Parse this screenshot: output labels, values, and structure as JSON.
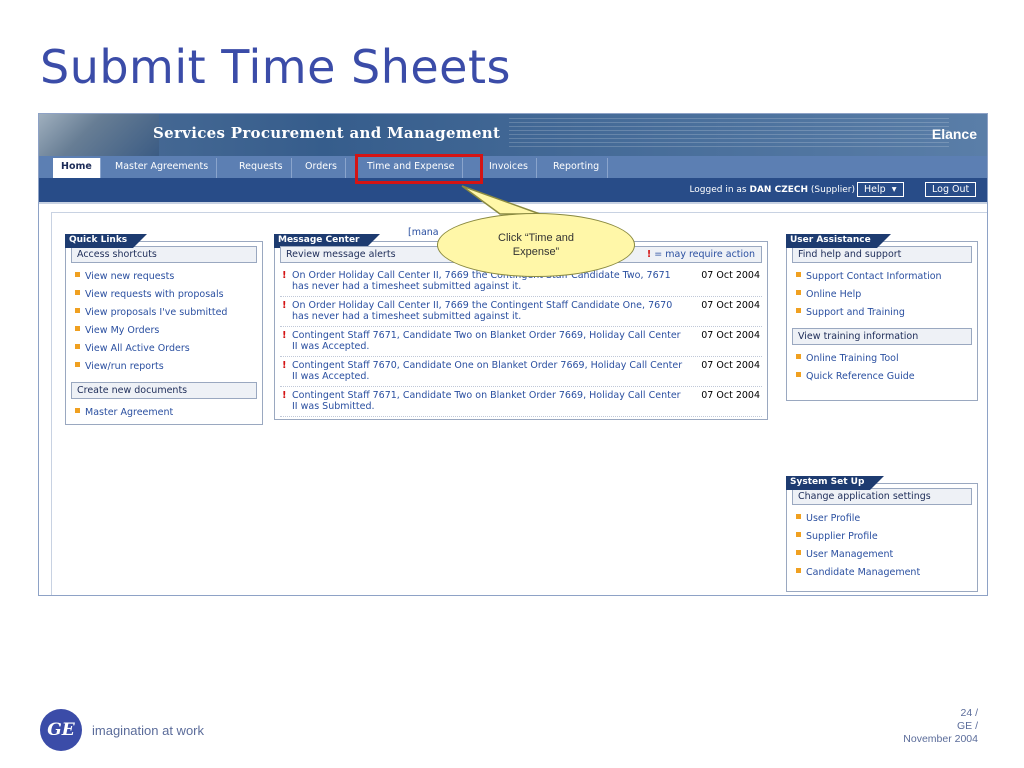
{
  "slide": {
    "title": "Submit Time Sheets",
    "callout": "Click “Time and Expense”",
    "tagline": "imagination at work",
    "logo_text": "GE",
    "page_number": "24 /",
    "company": "GE /",
    "date": "November 2004"
  },
  "app": {
    "banner_title": "Services Procurement and Management",
    "banner_logo": "Elance",
    "tabs": [
      {
        "label": "Home",
        "active": true
      },
      {
        "label": "Master Agreements",
        "active": false
      },
      {
        "label": "Requests",
        "active": false
      },
      {
        "label": "Orders",
        "active": false
      },
      {
        "label": "Time and Expense",
        "active": false
      },
      {
        "label": "Invoices",
        "active": false
      },
      {
        "label": "Reporting",
        "active": false
      }
    ],
    "logged_in_prefix": "Logged in as",
    "user_name": "DAN CZECH",
    "user_role": "(Supplier)",
    "help_label": "Help",
    "logout_label": "Log Out",
    "quick_links": {
      "title": "Quick Links",
      "section1": "Access shortcuts",
      "links1": [
        "View new requests",
        "View requests with proposals",
        "View proposals I've submitted",
        "View My Orders",
        "View All Active Orders",
        "View/run reports"
      ],
      "section2": "Create new documents",
      "links2": [
        "Master Agreement"
      ]
    },
    "message_center": {
      "title": "Message Center",
      "manage_link": "[mana",
      "review_label": "Review message alerts",
      "legend_mark": "!",
      "legend_text": "= may require action",
      "messages": [
        {
          "text": "On Order Holiday Call Center II, 7669 the Contingent Staff Candidate Two, 7671 has never had a timesheet submitted against it.",
          "date": "07 Oct 2004"
        },
        {
          "text": "On Order Holiday Call Center II, 7669 the Contingent Staff Candidate One, 7670 has never had a timesheet submitted against it.",
          "date": "07 Oct 2004"
        },
        {
          "text": "Contingent Staff 7671, Candidate Two on Blanket Order 7669, Holiday Call Center II was Accepted.",
          "date": "07 Oct 2004"
        },
        {
          "text": "Contingent Staff 7670, Candidate One on Blanket Order 7669, Holiday Call Center II was Accepted.",
          "date": "07 Oct 2004"
        },
        {
          "text": "Contingent Staff 7671, Candidate Two on Blanket Order 7669, Holiday Call Center II was Submitted.",
          "date": "07 Oct 2004"
        }
      ]
    },
    "user_assistance": {
      "title": "User Assistance",
      "section1": "Find help and support",
      "links1": [
        "Support Contact Information",
        "Online Help",
        "Support and Training"
      ],
      "section2": "View training information",
      "links2": [
        "Online Training Tool",
        "Quick Reference Guide"
      ]
    },
    "system_setup": {
      "title": "System Set Up",
      "section1": "Change application settings",
      "links1": [
        "User Profile",
        "Supplier Profile",
        "User Management",
        "Candidate Management"
      ]
    }
  },
  "colors": {
    "title": "#3b4ca8",
    "nav": "#284c88",
    "highlight": "#d41414",
    "callout": "#fff7a8",
    "bullet": "#f0a020"
  }
}
